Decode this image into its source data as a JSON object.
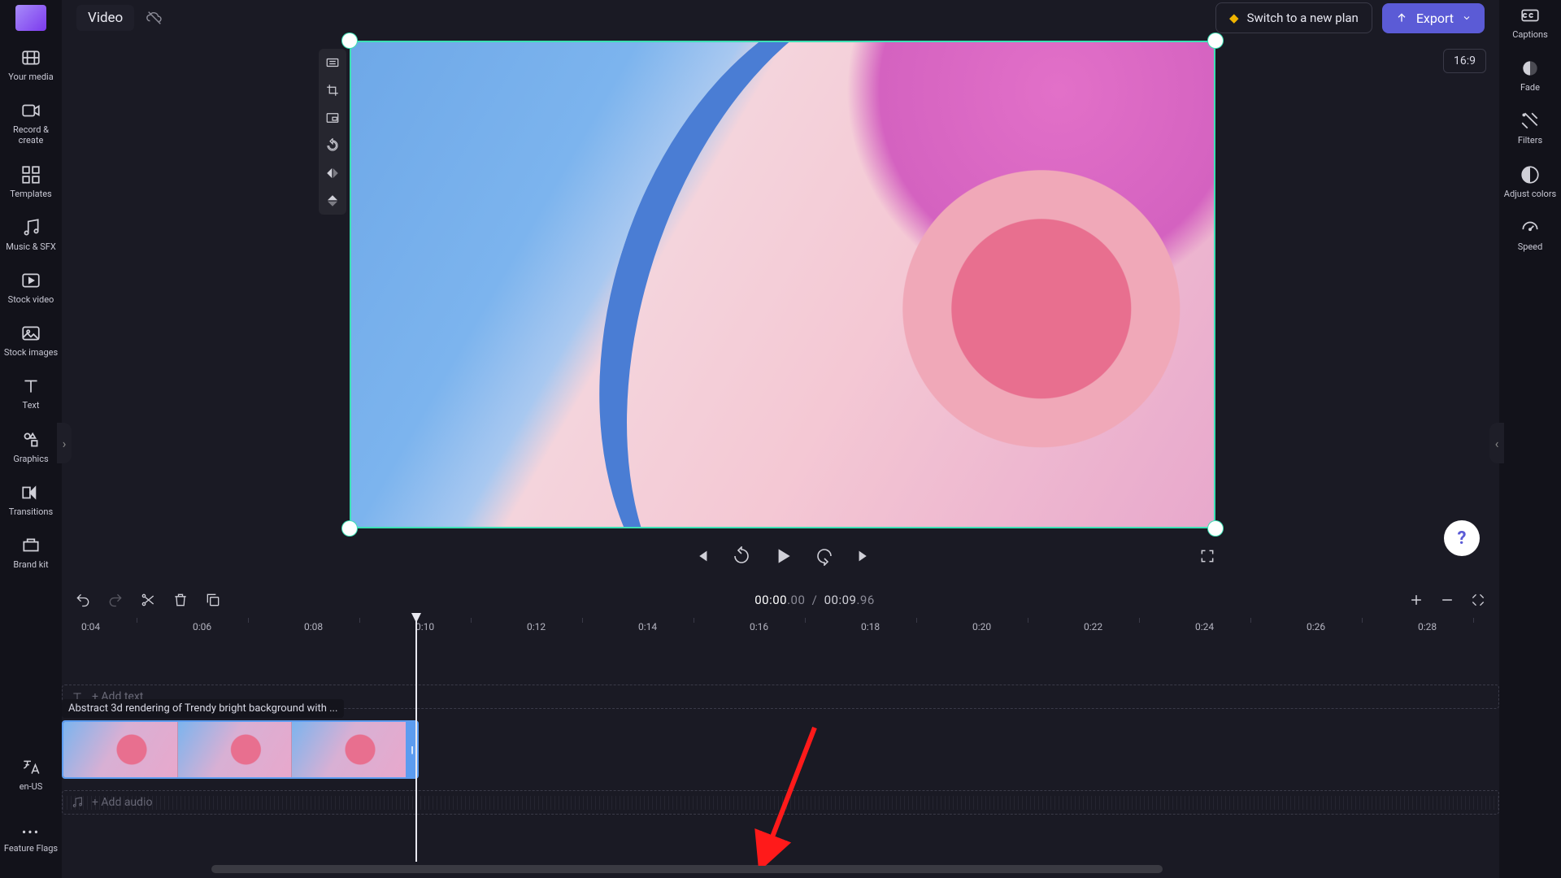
{
  "header": {
    "title": "Video",
    "plan_label": "Switch to a new plan",
    "export_label": "Export"
  },
  "left_sidebar": {
    "items": [
      {
        "label": "Your media"
      },
      {
        "label": "Record & create"
      },
      {
        "label": "Templates"
      },
      {
        "label": "Music & SFX"
      },
      {
        "label": "Stock video"
      },
      {
        "label": "Stock images"
      },
      {
        "label": "Text"
      },
      {
        "label": "Graphics"
      },
      {
        "label": "Transitions"
      },
      {
        "label": "Brand kit"
      }
    ],
    "bottom": {
      "locale": "en-US",
      "feature_flags": "Feature Flags"
    }
  },
  "right_sidebar": {
    "items": [
      {
        "label": "Captions"
      },
      {
        "label": "Fade"
      },
      {
        "label": "Filters"
      },
      {
        "label": "Adjust colors"
      },
      {
        "label": "Speed"
      }
    ]
  },
  "canvas": {
    "aspect_ratio": "16:9"
  },
  "timeline": {
    "current_time_main": "00:00",
    "current_time_frac": ".00",
    "sep": "/",
    "duration_main": "00:09",
    "duration_frac": ".96",
    "ruler": [
      "0:04",
      "0:06",
      "0:08",
      "0:10",
      "0:12",
      "0:14",
      "0:16",
      "0:18",
      "0:20",
      "0:22",
      "0:24",
      "0:26",
      "0:28"
    ],
    "clip_title": "Abstract 3d rendering of Trendy bright background with ...",
    "add_text_label": "+  Add text",
    "add_audio_label": "+  Add audio"
  },
  "icons": {
    "search": "search-icon",
    "cloud_off": "cloud-off-icon"
  }
}
